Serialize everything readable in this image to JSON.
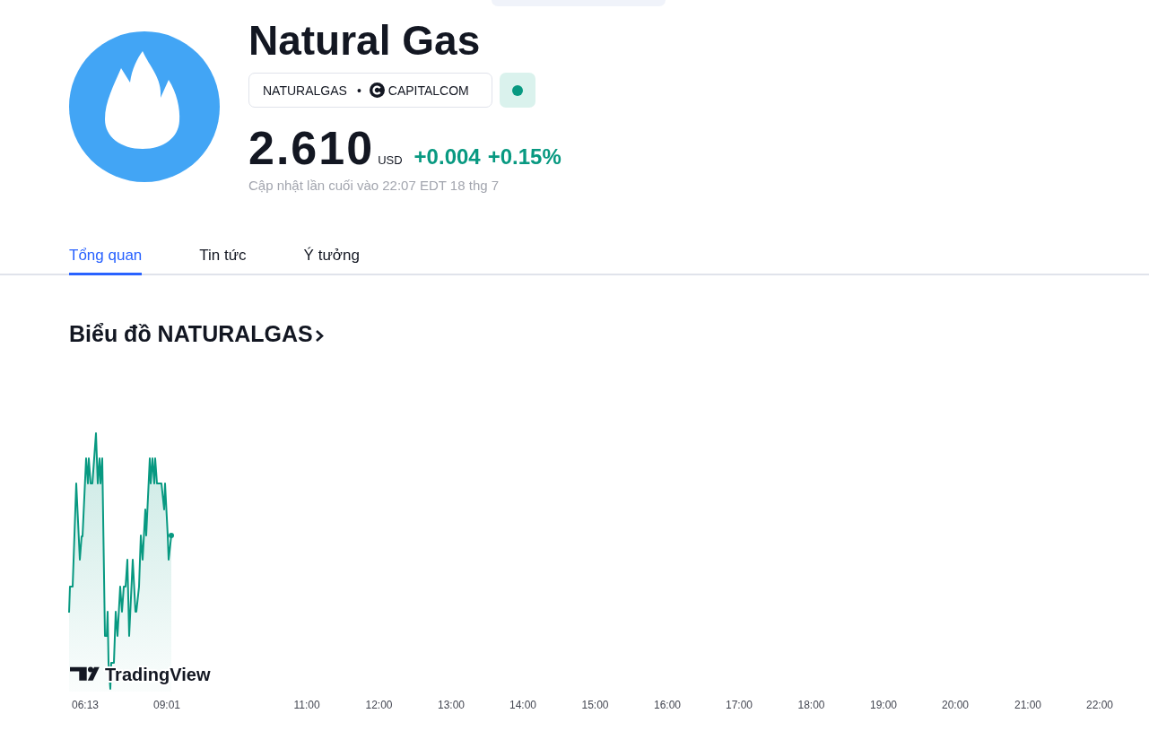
{
  "symbol": {
    "name": "Natural Gas",
    "ticker": "NATURALGAS",
    "separator": "•",
    "exchange": "CAPITALCOM",
    "market_open": true
  },
  "quote": {
    "price": "2.610",
    "currency": "USD",
    "change": "+0.004",
    "change_percent": "+0.15%",
    "rising": true,
    "updated": "Cập nhật lần cuối vào 22:07 EDT 18 thg 7"
  },
  "tabs": [
    {
      "label": "Tổng quan",
      "selected": true
    },
    {
      "label": "Tin tức",
      "selected": false
    },
    {
      "label": "Ý tưởng",
      "selected": false
    }
  ],
  "chart": {
    "title": "Biểu đồ NATURALGAS",
    "brand": "TradingView",
    "time_labels": [
      "06:13",
      "09:01",
      "11:00",
      "12:00",
      "13:00",
      "14:00",
      "15:00",
      "16:00",
      "17:00",
      "18:00",
      "19:00",
      "20:00",
      "21:00",
      "22:00"
    ]
  }
}
